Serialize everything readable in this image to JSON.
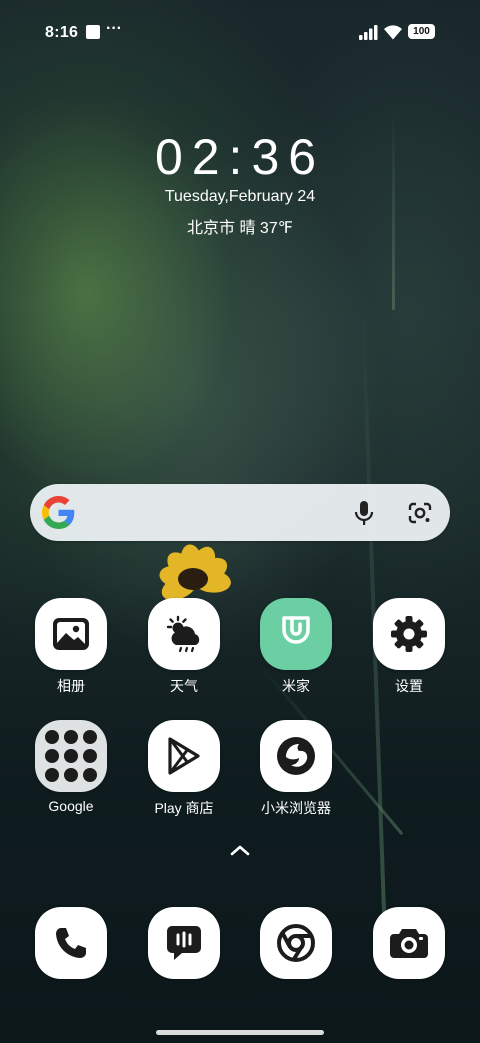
{
  "status_bar": {
    "time": "8:16",
    "more_indicator": "···",
    "battery_level": "100",
    "icons": [
      "notification-square-icon",
      "signal-icon",
      "wifi-icon",
      "battery-icon"
    ]
  },
  "clock_widget": {
    "time": "02:36",
    "date": "Tuesday,February 24",
    "weather": "北京市 晴 37℉"
  },
  "search_bar": {
    "icons": [
      "google-g-icon",
      "microphone-icon",
      "google-lens-icon"
    ]
  },
  "apps": {
    "row1": [
      {
        "label": "相册",
        "icon": "gallery-icon"
      },
      {
        "label": "天气",
        "icon": "weather-icon"
      },
      {
        "label": "米家",
        "icon": "mi-home-icon"
      },
      {
        "label": "设置",
        "icon": "settings-gear-icon"
      }
    ],
    "row2": [
      {
        "label": "Google",
        "icon": "google-folder-icon"
      },
      {
        "label": "Play 商店",
        "icon": "play-store-icon"
      },
      {
        "label": "小米浏览器",
        "icon": "mi-browser-icon"
      }
    ]
  },
  "app_drawer": {
    "icon": "chevron-up-icon"
  },
  "dock": [
    {
      "icon": "phone-icon"
    },
    {
      "icon": "messages-icon"
    },
    {
      "icon": "chrome-icon"
    },
    {
      "icon": "camera-icon"
    }
  ],
  "colors": {
    "mi_home_green": "#6ccfa3",
    "icon_background": "#ffffff",
    "icon_glyph": "#1c1c1c"
  }
}
